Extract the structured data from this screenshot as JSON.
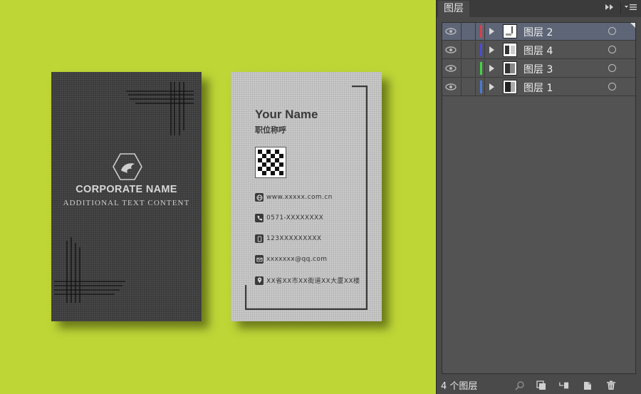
{
  "card_front": {
    "company_name": "CORPORATE NAME",
    "subtitle": "ADDITIONAL TEXT CONTENT"
  },
  "card_back": {
    "name": "Your Name",
    "job_title": "职位称呼",
    "contacts": [
      {
        "icon": "globe-icon",
        "text": "www.xxxxx.com.cn"
      },
      {
        "icon": "phone-icon",
        "text": "0571-XXXXXXXX"
      },
      {
        "icon": "mobile-icon",
        "text": "123XXXXXXXXX"
      },
      {
        "icon": "mail-icon",
        "text": "xxxxxxx@qq.com"
      },
      {
        "icon": "location-icon",
        "text": "XX省XX市XX街道XX大厦XX楼"
      }
    ]
  },
  "layers_panel": {
    "tab_label": "图层",
    "expand_icon": "double-chevron-right-icon",
    "menu_icon": "panel-menu-icon",
    "layers": [
      {
        "name": "图层 2",
        "color": "#d9404a",
        "selected": true
      },
      {
        "name": "图层 4",
        "color": "#4a4ad6",
        "selected": false
      },
      {
        "name": "图层 3",
        "color": "#3fd63f",
        "selected": false
      },
      {
        "name": "图层 1",
        "color": "#4a7ad6",
        "selected": false
      }
    ],
    "layer_count_label": "4 个图层",
    "footer_icons": [
      "search-icon",
      "clipping-mask-icon",
      "new-sublayer-icon",
      "new-layer-icon",
      "delete-icon"
    ]
  },
  "colors": {
    "canvas_bg": "#bfd637",
    "panel_bg": "#4a4a4a",
    "selected_row": "#5d6576"
  }
}
